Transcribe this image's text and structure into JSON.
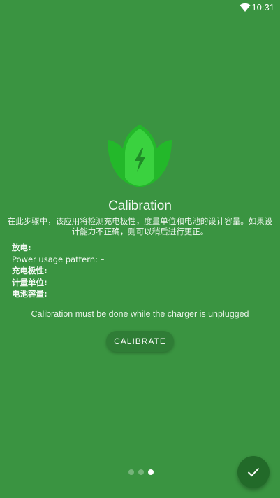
{
  "status_bar": {
    "time": "10:31",
    "wifi_icon": "wifi-icon"
  },
  "logo": {
    "icon": "battery-leaf-logo",
    "colors": {
      "leaf": "#3ad23f",
      "leaf_dark": "#23b82a",
      "bolt": "#1f8b27"
    }
  },
  "title": "Calibration",
  "description": "在此步骤中，该应用将检测充电极性，度量单位和电池的设计容量。如果设计能力不正确，则可以稍后进行更正。",
  "info": [
    {
      "label": "放电:",
      "value": " –"
    },
    {
      "label": "Power usage pattern:",
      "value": " –"
    },
    {
      "label": "充电极性:",
      "value": " –"
    },
    {
      "label": "计量单位:",
      "value": " –"
    },
    {
      "label": "电池容量:",
      "value": " –"
    }
  ],
  "hint": "Calibration must be done while the charger is unplugged",
  "calibrate_button": {
    "label": "CALIBRATE"
  },
  "pager": {
    "total": 3,
    "current": 3
  },
  "fab": {
    "icon": "check-icon"
  },
  "colors": {
    "background": "#3a9441",
    "button": "#2f7d36",
    "fab": "#226a29"
  }
}
